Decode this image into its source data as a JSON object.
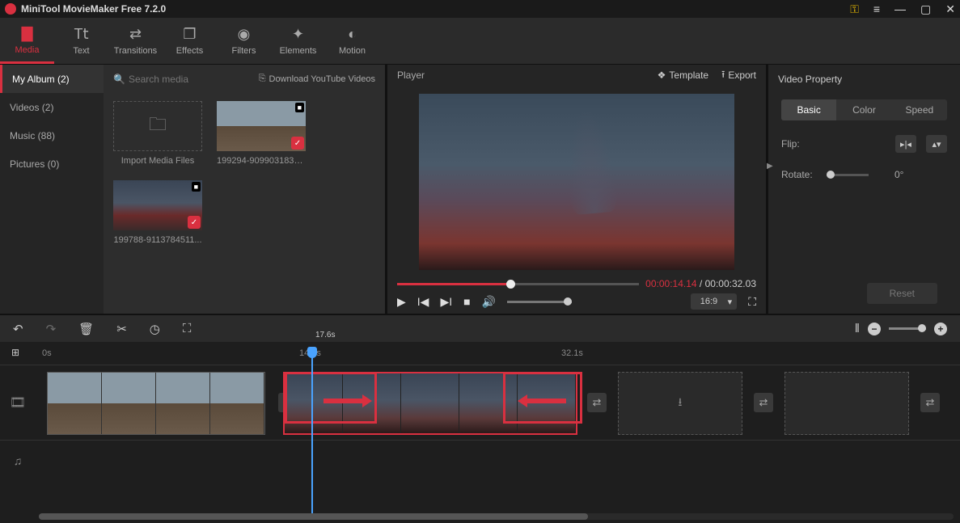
{
  "app": {
    "title": "MiniTool MovieMaker Free 7.2.0"
  },
  "toolbar": {
    "tabs": [
      {
        "label": "Media",
        "active": true
      },
      {
        "label": "Text"
      },
      {
        "label": "Transitions"
      },
      {
        "label": "Effects"
      },
      {
        "label": "Filters"
      },
      {
        "label": "Elements"
      },
      {
        "label": "Motion"
      }
    ]
  },
  "sidebar": {
    "items": [
      {
        "label": "My Album (2)",
        "active": true
      },
      {
        "label": "Videos (2)"
      },
      {
        "label": "Music (88)"
      },
      {
        "label": "Pictures (0)"
      }
    ]
  },
  "media": {
    "search_placeholder": "Search media",
    "download_label": "Download YouTube Videos",
    "import_label": "Import Media Files",
    "items": [
      {
        "label": "199294-9099031833..."
      },
      {
        "label": "199788-9113784511..."
      }
    ]
  },
  "player": {
    "title": "Player",
    "template_label": "Template",
    "export_label": "Export",
    "time_current": "00:00:14.14",
    "time_total": "00:00:32.03",
    "aspect": "16:9"
  },
  "property": {
    "title": "Video Property",
    "tabs": [
      "Basic",
      "Color",
      "Speed"
    ],
    "flip_label": "Flip:",
    "rotate_label": "Rotate:",
    "rotate_value": "0°",
    "reset_label": "Reset"
  },
  "timeline": {
    "markers": {
      "m0": "0s",
      "m1": "14.6s",
      "m2": "32.1s"
    },
    "playhead_label": "17.6s"
  }
}
